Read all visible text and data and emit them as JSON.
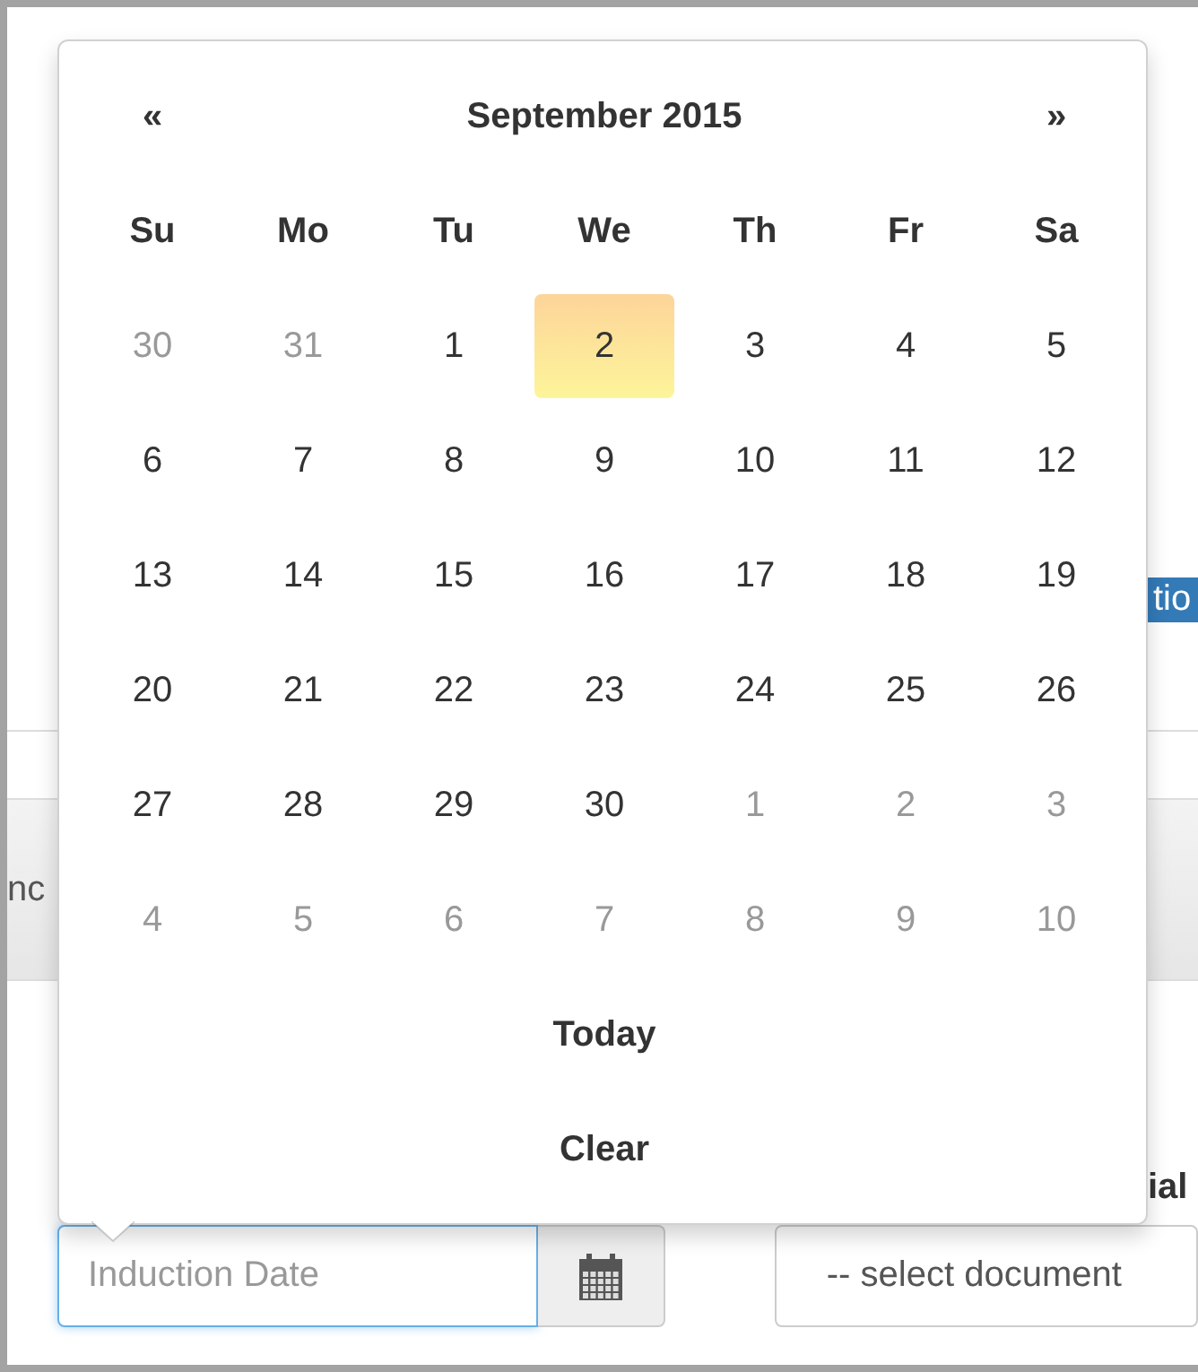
{
  "background": {
    "button_text": "tio",
    "tab_text": "nc",
    "label_text": "ial"
  },
  "datepicker": {
    "prev": "«",
    "title": "September 2015",
    "next": "»",
    "weekdays": [
      "Su",
      "Mo",
      "Tu",
      "We",
      "Th",
      "Fr",
      "Sa"
    ],
    "weeks": [
      [
        {
          "day": "30",
          "muted": true,
          "selected": false
        },
        {
          "day": "31",
          "muted": true,
          "selected": false
        },
        {
          "day": "1",
          "muted": false,
          "selected": false
        },
        {
          "day": "2",
          "muted": false,
          "selected": true
        },
        {
          "day": "3",
          "muted": false,
          "selected": false
        },
        {
          "day": "4",
          "muted": false,
          "selected": false
        },
        {
          "day": "5",
          "muted": false,
          "selected": false
        }
      ],
      [
        {
          "day": "6",
          "muted": false,
          "selected": false
        },
        {
          "day": "7",
          "muted": false,
          "selected": false
        },
        {
          "day": "8",
          "muted": false,
          "selected": false
        },
        {
          "day": "9",
          "muted": false,
          "selected": false
        },
        {
          "day": "10",
          "muted": false,
          "selected": false
        },
        {
          "day": "11",
          "muted": false,
          "selected": false
        },
        {
          "day": "12",
          "muted": false,
          "selected": false
        }
      ],
      [
        {
          "day": "13",
          "muted": false,
          "selected": false
        },
        {
          "day": "14",
          "muted": false,
          "selected": false
        },
        {
          "day": "15",
          "muted": false,
          "selected": false
        },
        {
          "day": "16",
          "muted": false,
          "selected": false
        },
        {
          "day": "17",
          "muted": false,
          "selected": false
        },
        {
          "day": "18",
          "muted": false,
          "selected": false
        },
        {
          "day": "19",
          "muted": false,
          "selected": false
        }
      ],
      [
        {
          "day": "20",
          "muted": false,
          "selected": false
        },
        {
          "day": "21",
          "muted": false,
          "selected": false
        },
        {
          "day": "22",
          "muted": false,
          "selected": false
        },
        {
          "day": "23",
          "muted": false,
          "selected": false
        },
        {
          "day": "24",
          "muted": false,
          "selected": false
        },
        {
          "day": "25",
          "muted": false,
          "selected": false
        },
        {
          "day": "26",
          "muted": false,
          "selected": false
        }
      ],
      [
        {
          "day": "27",
          "muted": false,
          "selected": false
        },
        {
          "day": "28",
          "muted": false,
          "selected": false
        },
        {
          "day": "29",
          "muted": false,
          "selected": false
        },
        {
          "day": "30",
          "muted": false,
          "selected": false
        },
        {
          "day": "1",
          "muted": true,
          "selected": false
        },
        {
          "day": "2",
          "muted": true,
          "selected": false
        },
        {
          "day": "3",
          "muted": true,
          "selected": false
        }
      ],
      [
        {
          "day": "4",
          "muted": true,
          "selected": false
        },
        {
          "day": "5",
          "muted": true,
          "selected": false
        },
        {
          "day": "6",
          "muted": true,
          "selected": false
        },
        {
          "day": "7",
          "muted": true,
          "selected": false
        },
        {
          "day": "8",
          "muted": true,
          "selected": false
        },
        {
          "day": "9",
          "muted": true,
          "selected": false
        },
        {
          "day": "10",
          "muted": true,
          "selected": false
        }
      ]
    ],
    "today_button": "Today",
    "clear_button": "Clear"
  },
  "date_field": {
    "placeholder": "Induction Date",
    "focused": true
  },
  "document_select": {
    "value": "-- select document"
  }
}
